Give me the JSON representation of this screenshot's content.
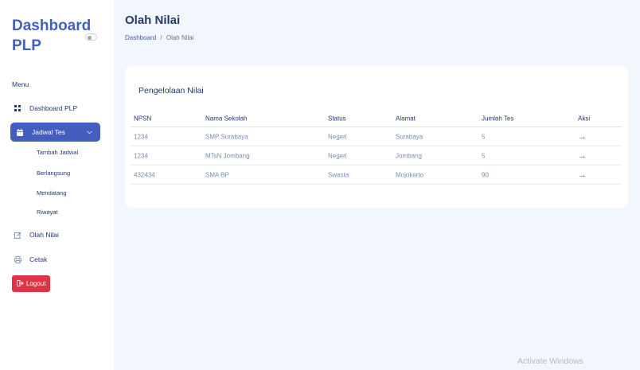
{
  "sidebar": {
    "brand": "Dashboard PLP",
    "menu_title": "Menu",
    "items": {
      "dashboard": "Dashboard PLP",
      "jadwal": "Jadwal Tes",
      "olah": "Olah Nilai",
      "cetak": "Cetak"
    },
    "subitems": [
      "Tambah Jadwal",
      "Berlangsung",
      "Mendatang",
      "Riwayat"
    ],
    "logout": "Logout"
  },
  "header": {
    "title": "Olah Nilai",
    "breadcrumb": {
      "home": "Dashboard",
      "separator": "/",
      "current": "Olah Nilai"
    }
  },
  "card": {
    "title": "Pengelolaan Nilai",
    "columns": [
      "NPSN",
      "Nama Sekolah",
      "Status",
      "Alamat",
      "Jumlah Tes",
      "Aksi"
    ],
    "rows": [
      {
        "npsn": "1234",
        "nama": "SMP Surabaya",
        "status": "Negeri",
        "alamat": "Surabaya",
        "jumlah": "5",
        "aksi": "→"
      },
      {
        "npsn": "1234",
        "nama": "MTsN Jombang",
        "status": "Negeri",
        "alamat": "Jombang",
        "jumlah": "5",
        "aksi": "→"
      },
      {
        "npsn": "432434",
        "nama": "SMA BP",
        "status": "Swasta",
        "alamat": "Mojokerto",
        "jumlah": "90",
        "aksi": "→"
      }
    ]
  },
  "watermark": "Activate Windows",
  "colors": {
    "accent": "#435ebe",
    "danger": "#dc3545",
    "background": "#f2f6fd",
    "text": "#25396f"
  }
}
